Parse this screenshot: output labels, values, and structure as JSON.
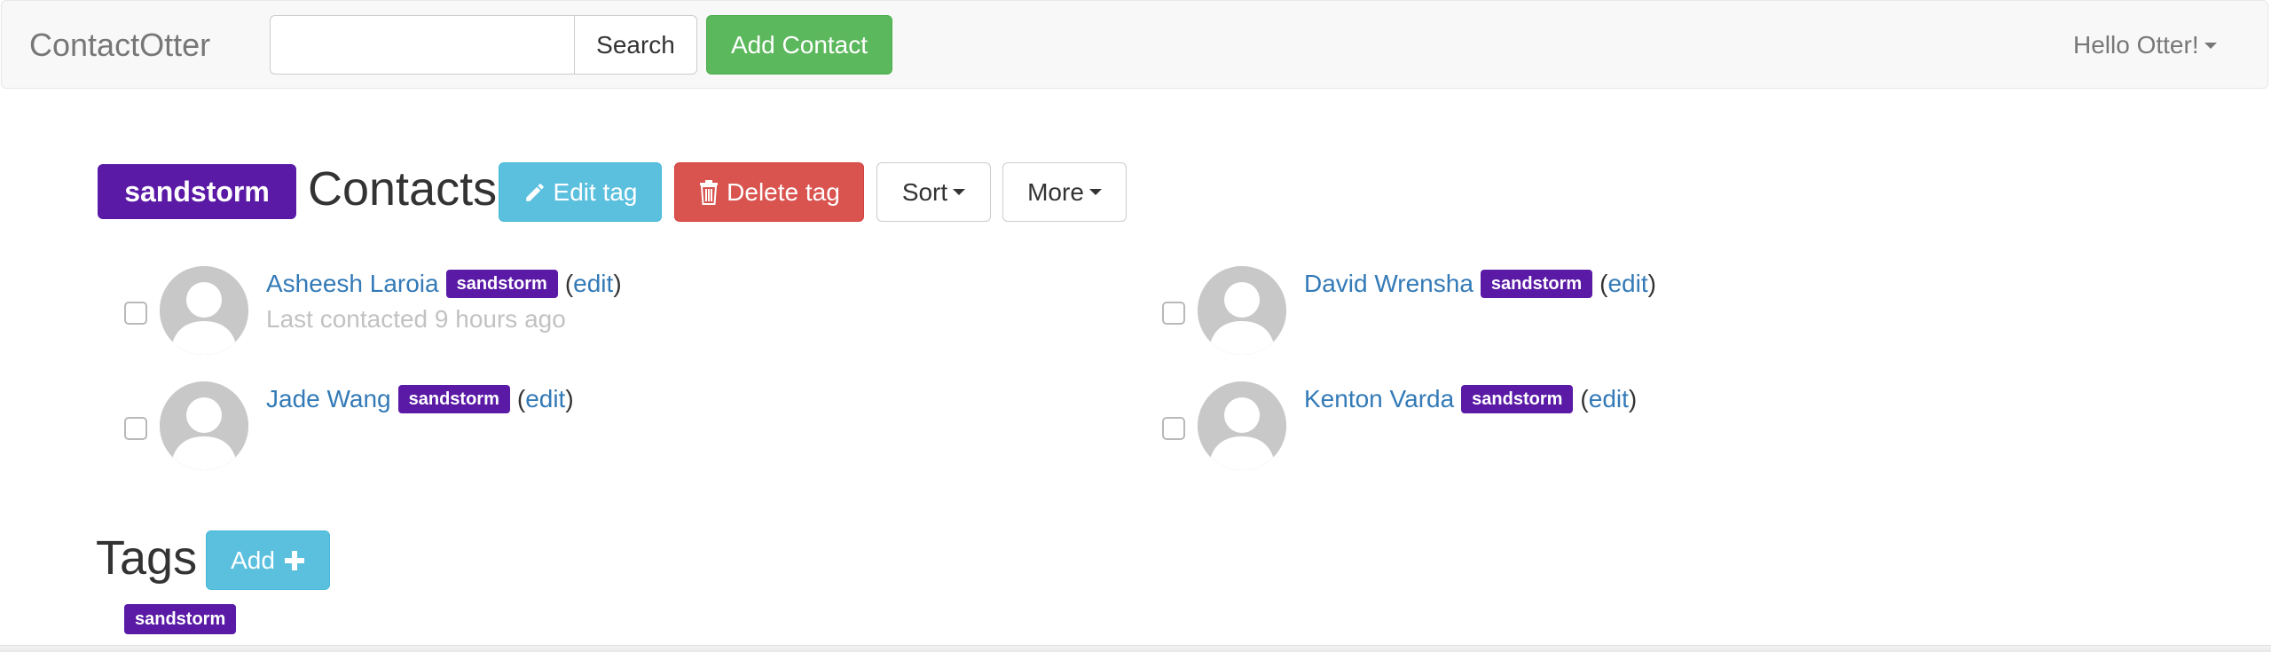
{
  "navbar": {
    "brand": "ContactOtter",
    "search": {
      "value": "",
      "placeholder": ""
    },
    "search_button": "Search",
    "add_contact_button": "Add Contact",
    "user_menu": "Hello Otter!"
  },
  "header": {
    "tag": "sandstorm",
    "title": "Contacts",
    "edit_tag_button": "Edit tag",
    "delete_tag_button": "Delete tag",
    "sort_button": "Sort",
    "more_button": "More"
  },
  "contacts": [
    {
      "name": "Asheesh Laroia",
      "tag": "sandstorm",
      "open_paren": "(",
      "edit": "edit",
      "close_paren": ")",
      "last_contacted": "Last contacted 9 hours ago"
    },
    {
      "name": "David Wrensha",
      "tag": "sandstorm",
      "open_paren": "(",
      "edit": "edit",
      "close_paren": ")"
    },
    {
      "name": "Jade Wang",
      "tag": "sandstorm",
      "open_paren": "(",
      "edit": "edit",
      "close_paren": ")"
    },
    {
      "name": "Kenton Varda",
      "tag": "sandstorm",
      "open_paren": "(",
      "edit": "edit",
      "close_paren": ")"
    }
  ],
  "tags_section": {
    "title": "Tags",
    "add_button": "Add",
    "items": [
      "sandstorm"
    ]
  },
  "colors": {
    "tag_purple": "#5a1aa6",
    "link_blue": "#337ab7",
    "success_green": "#5cb85c",
    "info_blue": "#5bc0de",
    "danger_red": "#d9534f",
    "muted_gray": "#c2c2c2"
  },
  "icons": {
    "edit_tag": "pencil-icon",
    "delete_tag": "trash-icon",
    "add_tag": "plus-icon",
    "avatar": "default-avatar-icon",
    "dropdown": "caret-down-icon"
  }
}
